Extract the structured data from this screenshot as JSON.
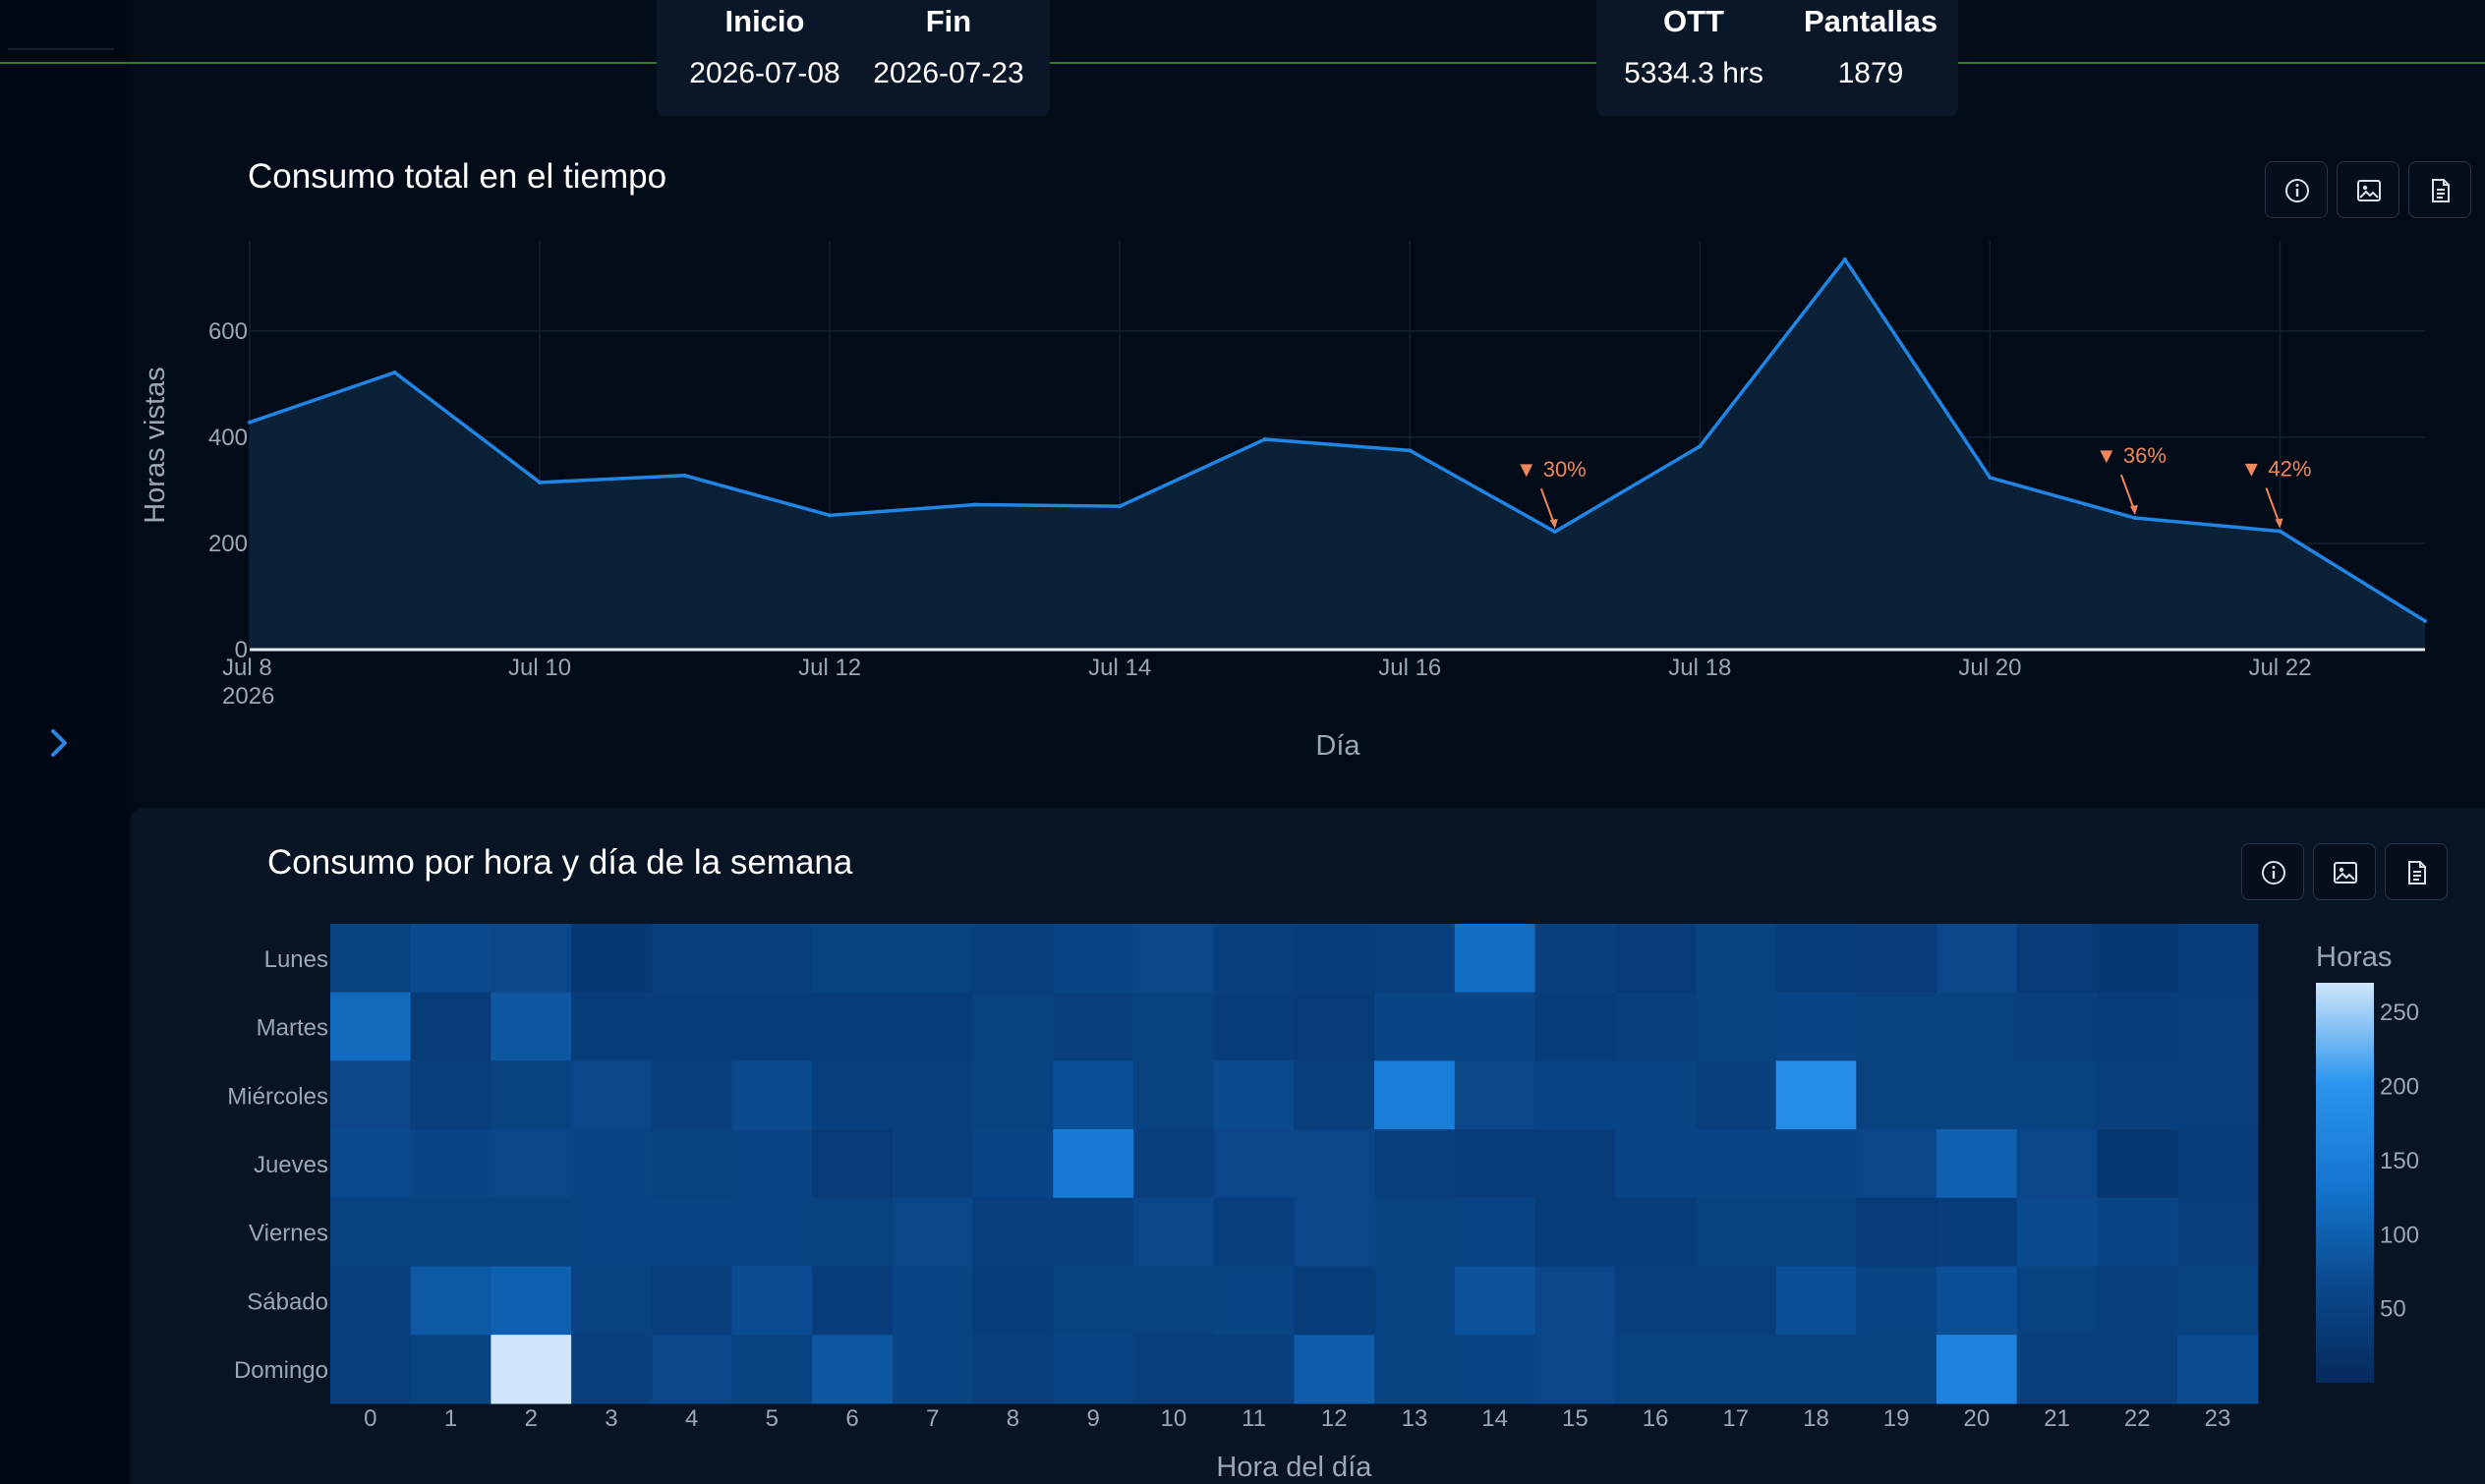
{
  "stats": {
    "dates": {
      "start_label": "Inicio",
      "end_label": "Fin",
      "start_value": "2026-07-08",
      "end_value": "2026-07-23"
    },
    "totals": {
      "ott_label": "OTT",
      "screens_label": "Pantallas",
      "ott_value": "5334.3 hrs",
      "screens_value": "1879"
    }
  },
  "toolbar_icons": [
    "info-icon",
    "image-icon",
    "document-icon"
  ],
  "chart_data": [
    {
      "type": "area",
      "title": "Consumo total en el tiempo",
      "xlabel": "Día",
      "ylabel": "Horas vistas",
      "x": [
        "2026-07-08",
        "2026-07-09",
        "2026-07-10",
        "2026-07-11",
        "2026-07-12",
        "2026-07-13",
        "2026-07-14",
        "2026-07-15",
        "2026-07-16",
        "2026-07-17",
        "2026-07-18",
        "2026-07-19",
        "2026-07-20",
        "2026-07-21",
        "2026-07-22",
        "2026-07-23"
      ],
      "y": [
        428,
        522,
        315,
        328,
        253,
        273,
        270,
        396,
        375,
        222,
        383,
        735,
        324,
        248,
        223,
        54
      ],
      "ylim": [
        0,
        770
      ],
      "yticks": [
        0,
        200,
        400,
        600
      ],
      "xticks": [
        {
          "x": "2026-07-08",
          "label": "Jul 8",
          "sub": "2026"
        },
        {
          "x": "2026-07-10",
          "label": "Jul 10"
        },
        {
          "x": "2026-07-12",
          "label": "Jul 12"
        },
        {
          "x": "2026-07-14",
          "label": "Jul 14"
        },
        {
          "x": "2026-07-16",
          "label": "Jul 16"
        },
        {
          "x": "2026-07-18",
          "label": "Jul 18"
        },
        {
          "x": "2026-07-20",
          "label": "Jul 20"
        },
        {
          "x": "2026-07-22",
          "label": "Jul 22"
        }
      ],
      "annotations": [
        {
          "x": "2026-07-17",
          "y": 222,
          "text": "▼ 30%"
        },
        {
          "x": "2026-07-21",
          "y": 248,
          "text": "▼ 36%"
        },
        {
          "x": "2026-07-22",
          "y": 223,
          "text": "▼ 42%"
        }
      ],
      "grid": true,
      "line_color": "#1f86e6",
      "fill_color": "#0b2138",
      "annotation_color": "#f0875a"
    },
    {
      "type": "heatmap",
      "title": "Consumo por hora y día de la semana",
      "xlabel": "Hora del día",
      "ylabel": "",
      "x": [
        "0",
        "1",
        "2",
        "3",
        "4",
        "5",
        "6",
        "7",
        "8",
        "9",
        "10",
        "11",
        "12",
        "13",
        "14",
        "15",
        "16",
        "17",
        "18",
        "19",
        "20",
        "21",
        "22",
        "23"
      ],
      "y": [
        "Lunes",
        "Martes",
        "Miércoles",
        "Jueves",
        "Viernes",
        "Sábado",
        "Domingo"
      ],
      "z": [
        [
          50,
          65,
          60,
          30,
          45,
          45,
          50,
          50,
          45,
          55,
          60,
          45,
          40,
          45,
          120,
          45,
          35,
          50,
          40,
          35,
          60,
          35,
          30,
          40
        ],
        [
          115,
          35,
          85,
          40,
          40,
          40,
          40,
          40,
          50,
          45,
          50,
          40,
          35,
          55,
          55,
          40,
          45,
          50,
          55,
          50,
          50,
          45,
          40,
          45
        ],
        [
          60,
          45,
          50,
          60,
          45,
          65,
          45,
          45,
          50,
          75,
          50,
          65,
          45,
          150,
          60,
          55,
          55,
          45,
          185,
          50,
          50,
          50,
          45,
          45
        ],
        [
          65,
          55,
          60,
          55,
          50,
          55,
          35,
          45,
          55,
          145,
          45,
          60,
          60,
          45,
          40,
          40,
          55,
          55,
          55,
          60,
          100,
          60,
          30,
          40
        ],
        [
          50,
          50,
          50,
          55,
          55,
          55,
          50,
          60,
          45,
          45,
          60,
          45,
          60,
          50,
          55,
          40,
          40,
          50,
          50,
          35,
          40,
          65,
          55,
          45
        ],
        [
          45,
          90,
          100,
          50,
          45,
          70,
          40,
          55,
          40,
          50,
          50,
          55,
          40,
          50,
          80,
          60,
          45,
          45,
          75,
          55,
          75,
          50,
          45,
          50
        ],
        [
          45,
          50,
          270,
          45,
          60,
          50,
          85,
          55,
          45,
          55,
          45,
          45,
          95,
          50,
          55,
          60,
          50,
          50,
          50,
          50,
          165,
          45,
          45,
          70
        ]
      ],
      "colorbar": {
        "title": "Horas",
        "ticks": [
          50,
          100,
          150,
          200,
          250
        ],
        "range": [
          0,
          270
        ]
      },
      "colorscale": [
        "#062a5c",
        "#0a4a8e",
        "#1477d2",
        "#2b95ef",
        "#cfe6fb"
      ]
    }
  ]
}
